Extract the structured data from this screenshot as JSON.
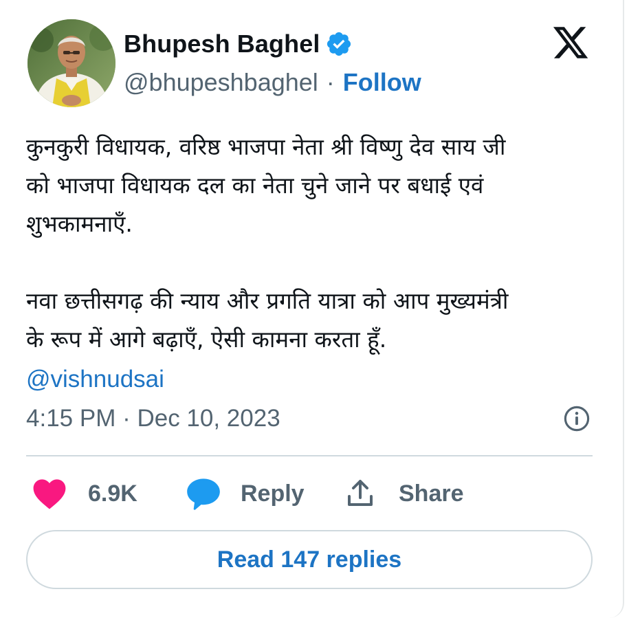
{
  "author": {
    "display_name": "Bhupesh Baghel",
    "handle": "@bhupeshbaghel",
    "separator": "·",
    "follow_label": "Follow",
    "verified": true
  },
  "tweet": {
    "paragraphs": [
      [
        "कुनकुरी विधायक, वरिष्ठ भाजपा नेता श्री विष्णु देव साय जी",
        "को भाजपा विधायक दल का नेता चुने जाने पर बधाई एवं",
        "शुभकामनाएँ."
      ],
      [
        "नवा छत्तीसगढ़ की न्याय और प्रगति यात्रा को आप मुख्यमंत्री",
        "के रूप में आगे बढ़ाएँ, ऐसी कामना करता हूँ."
      ]
    ],
    "mention": "@vishnudsai",
    "timestamp": "4:15 PM · Dec 10, 2023"
  },
  "actions": {
    "like_count": "6.9K",
    "reply_label": "Reply",
    "share_label": "Share"
  },
  "read_replies_label": "Read 147 replies",
  "colors": {
    "accent": "#1d74c4",
    "like": "#f91880",
    "reply": "#1d9bf0",
    "muted": "#536471",
    "verified": "#1d9bf0"
  },
  "icons": {
    "brand": "x-logo-icon",
    "verified": "verified-badge-icon",
    "info": "info-icon",
    "like": "heart-icon",
    "reply": "speech-bubble-icon",
    "share": "share-upload-icon"
  }
}
